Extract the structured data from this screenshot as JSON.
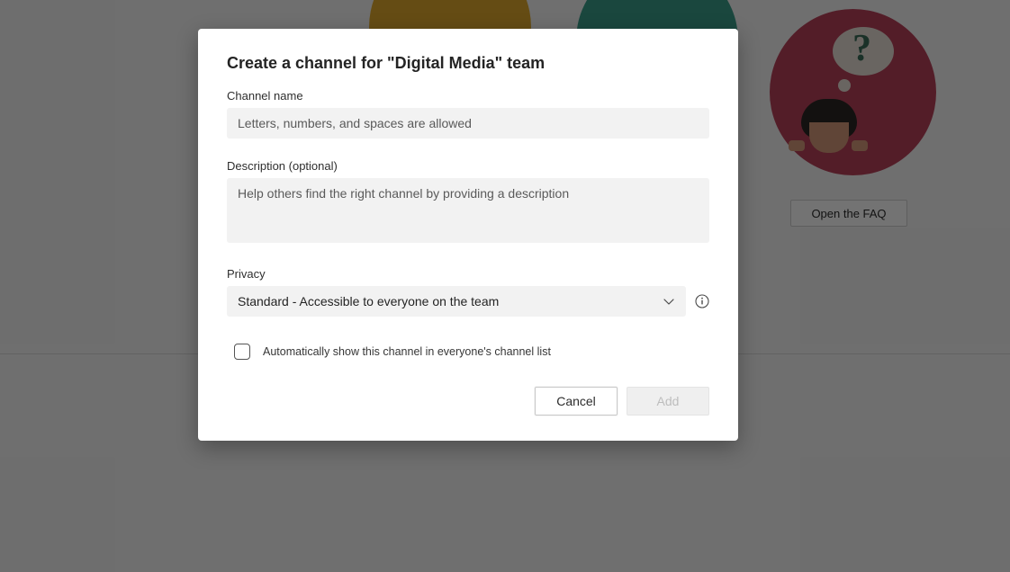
{
  "background": {
    "faq_button": "Open the FAQ"
  },
  "modal": {
    "title": "Create a channel for \"Digital Media\" team",
    "channel_name": {
      "label": "Channel name",
      "placeholder": "Letters, numbers, and spaces are allowed",
      "value": ""
    },
    "description": {
      "label": "Description (optional)",
      "placeholder": "Help others find the right channel by providing a description",
      "value": ""
    },
    "privacy": {
      "label": "Privacy",
      "selected": "Standard - Accessible to everyone on the team"
    },
    "auto_show": {
      "label": "Automatically show this channel in everyone's channel list",
      "checked": false
    },
    "buttons": {
      "cancel": "Cancel",
      "add": "Add"
    }
  }
}
